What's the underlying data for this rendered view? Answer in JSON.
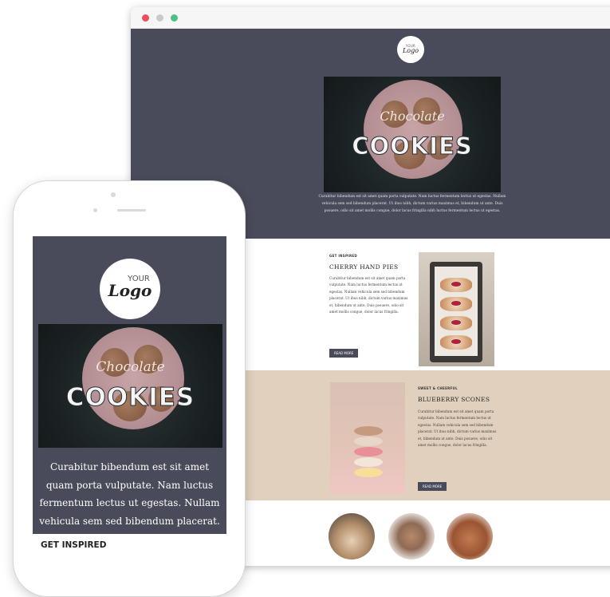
{
  "desktop": {
    "window_controls": [
      "close",
      "minimize",
      "maximize"
    ],
    "logo": {
      "top_text": "YOUR",
      "script_text": "Logo"
    },
    "hero": {
      "image_script": "Chocolate",
      "image_word": "COOKIES",
      "text": "Curabitur bibendum est sit amet quam porta vulputate. Nam luctus fermentum lectus ut egestas. Nullam vehicula sem sed bibendum placerat. Ut ibus nibh, dictum varius maximus et, bibendum ut ante. Duis posuere, odio sit amet mollis congue, dolor lacus fringilla nibh luctus fermentum lectus ut egestas."
    },
    "section1": {
      "eyebrow": "GET INSPIRED",
      "title": "CHERRY HAND PIES",
      "body": "Curabitur bibendum est sit amet quam porta vulputate. Nam luctus fermentum lectus ut egestas. Nullam vehicula sem sed bibendum placerat. Ut ibus nibh, dictum varius maximus et, bibendum ut ante. Duis posuere, odio sit amet mollis congue, dolor lacus fringilla.",
      "button": "READ MORE"
    },
    "section2": {
      "eyebrow": "SWEET & CHEERFUL",
      "title": "BLUEBERRY SCONES",
      "body": "Curabitur bibendum est sit amet quam porta vulputate. Nam luctus fermentum lectus ut egestas. Nullam vehicula sem sed bibendum placerat. Ut ibus nibh, dictum varius maximus et, bibendum ut ante. Duis posuere, odio sit amet mollis congue, dolor lacus fringilla.",
      "button": "READ MORE"
    }
  },
  "mobile": {
    "logo": {
      "top_text": "YOUR",
      "script_text": "Logo"
    },
    "hero": {
      "image_script": "Chocolate",
      "image_word": "COOKIES",
      "text": "Curabitur bibendum est sit amet quam porta vulputate. Nam luctus fermentum lectus ut egestas. Nullam vehicula sem sed bibendum placerat."
    },
    "eyebrow": "GET INSPIRED"
  },
  "colors": {
    "hero_bg": "#4a4b5a",
    "beige_bg": "#e0d0bd",
    "button_bg": "#4a4b5a",
    "close_dot": "#e8505b",
    "min_dot": "#c9c9c9",
    "max_dot": "#4fc083"
  }
}
